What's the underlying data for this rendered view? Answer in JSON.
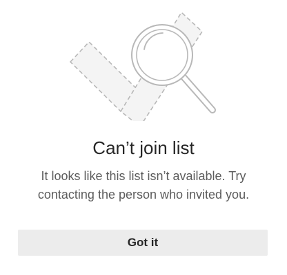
{
  "dialog": {
    "title": "Can’t join list",
    "message": "It looks like this list isn’t available. Try contacting the person who invited you.",
    "primary_button_label": "Got it"
  },
  "illustration": {
    "icon": "magnifier-over-broken-list-icon",
    "stroke_color": "#b8b8b8",
    "fill_color": "#f4f4f4"
  },
  "colors": {
    "title": "#262626",
    "message": "#5c5c5c",
    "button_bg": "#ececec"
  }
}
